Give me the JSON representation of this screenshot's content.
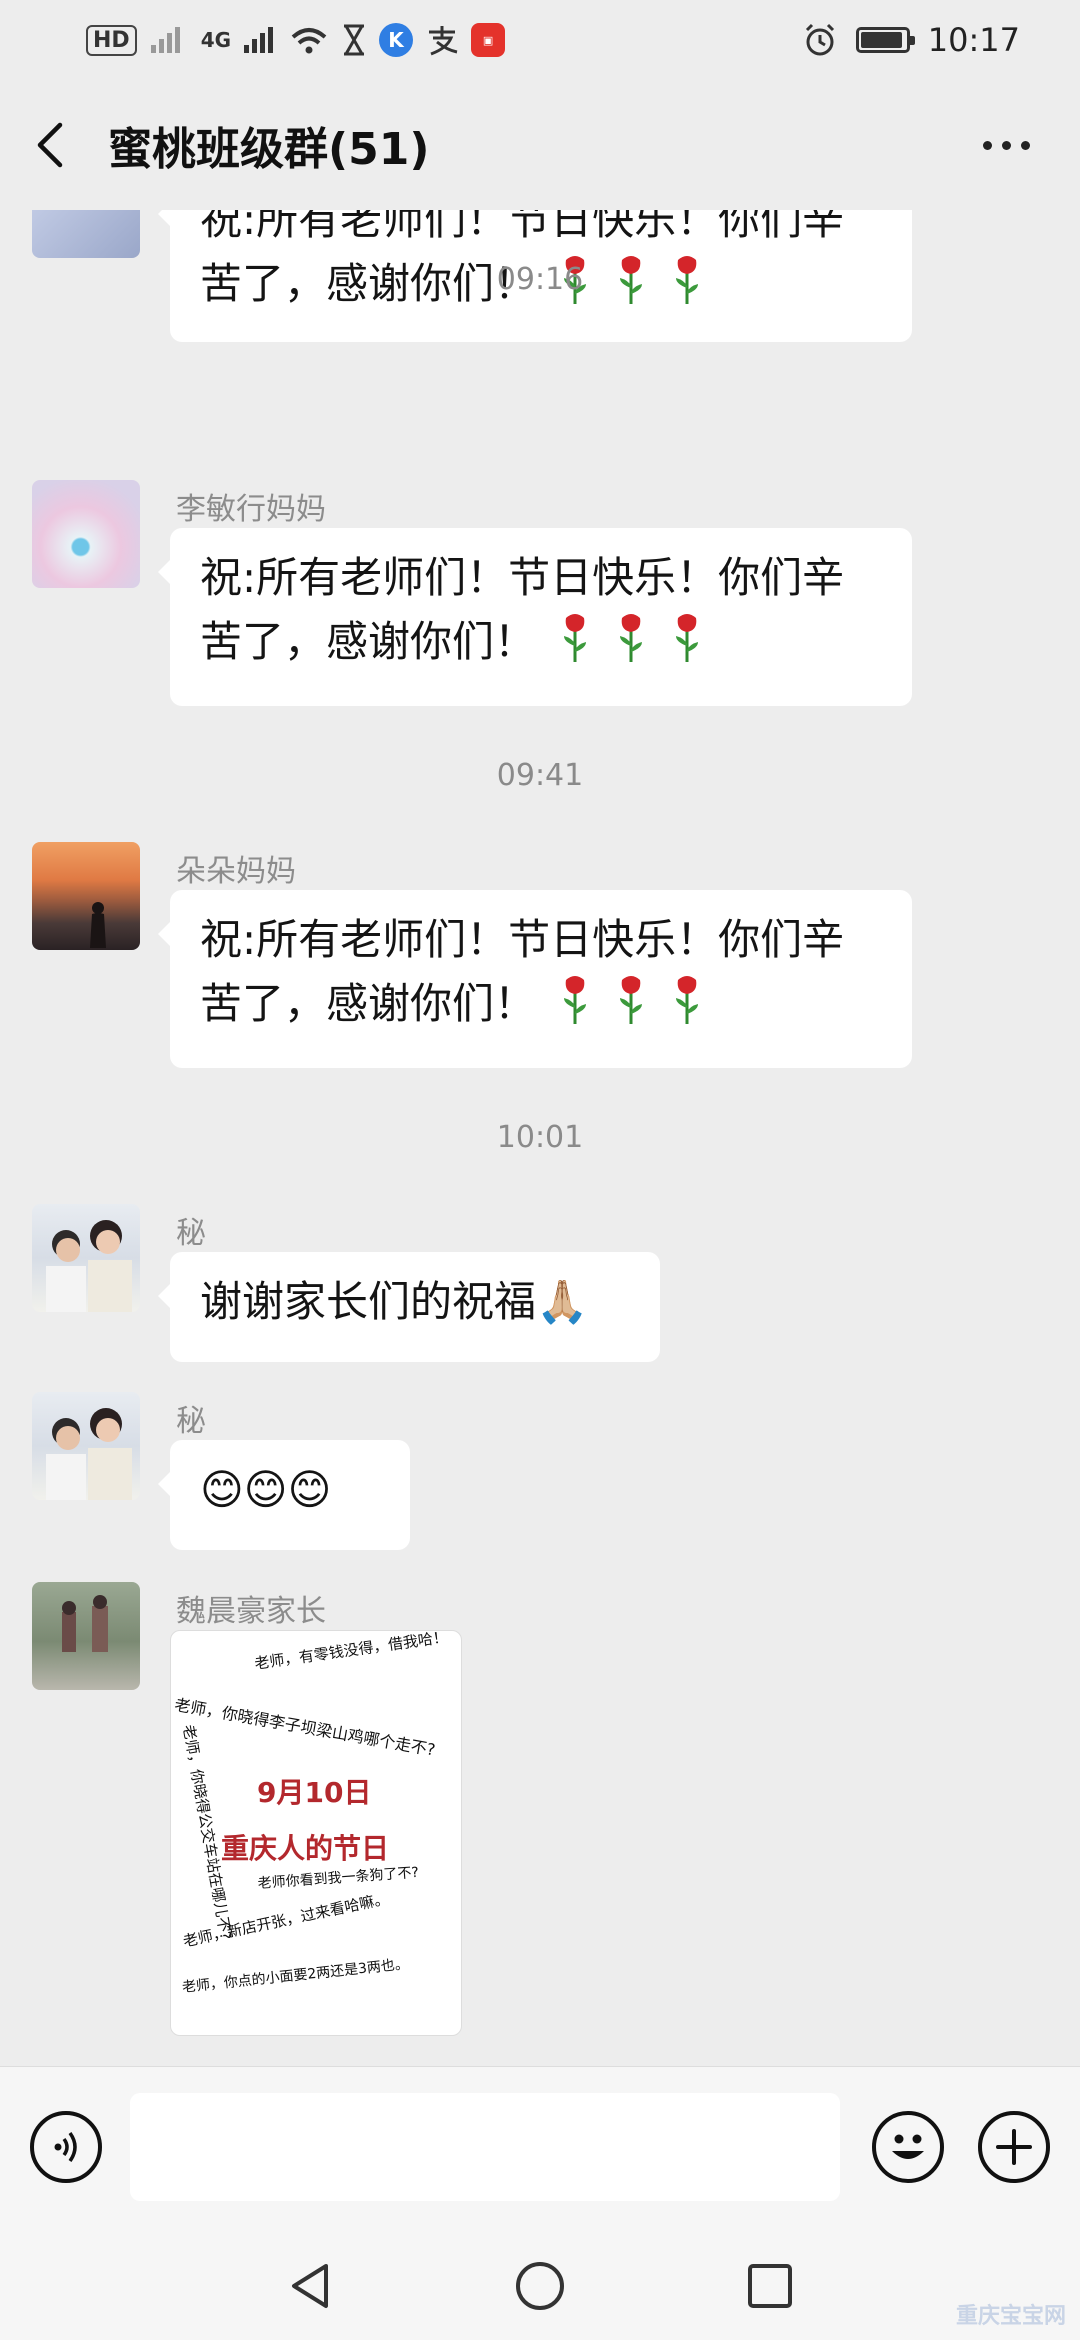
{
  "status_bar": {
    "left_chips": [
      "HD",
      "4G"
    ],
    "time": "10:17",
    "battery_level": 0.85
  },
  "header": {
    "back_icon": "chevron-left-icon",
    "title": "蜜桃班级群(51)",
    "more_icon": "more-dots-icon"
  },
  "messages": [
    {
      "type": "bubble",
      "text": "祝:所有老师们！节日快乐！你们辛苦了，感谢你们！",
      "roses": 3,
      "partial": true
    },
    {
      "type": "time",
      "text": "09:16"
    },
    {
      "type": "bubble",
      "sender": "李敏行妈妈",
      "text": "祝:所有老师们！节日快乐！你们辛苦了，感谢你们！",
      "roses": 3
    },
    {
      "type": "time",
      "text": "09:41"
    },
    {
      "type": "bubble",
      "sender": "朵朵妈妈",
      "text": "祝:所有老师们！节日快乐！你们辛苦了，感谢你们！",
      "roses": 3
    },
    {
      "type": "time",
      "text": "10:01"
    },
    {
      "type": "bubble",
      "sender": "秘",
      "text": "谢谢家长们的祝福",
      "emoji": "🙏🏼"
    },
    {
      "type": "bubble",
      "sender": "秘",
      "text": "😊😊😊"
    },
    {
      "type": "image",
      "sender": "魏晨豪家长"
    }
  ],
  "image_card": {
    "lines": [
      "老师，有零钱没得，借我哈！",
      "老师，你晓得李子坝梁山鸡哪个走不?",
      "老师，你晓得公交车站在哪儿不?",
      "9月10日",
      "重庆人的节日",
      "老师你看到我一条狗了不?",
      "老师，新店开张，过来看哈嘛。",
      "老师，你点的小面要2两还是3两也。"
    ]
  },
  "input_bar": {
    "voice_icon": "voice-icon",
    "emoji_icon": "emoji-icon",
    "plus_icon": "plus-icon"
  },
  "nav_bar": {
    "back_icon": "nav-back-icon",
    "home_icon": "nav-home-icon",
    "recents_icon": "nav-recents-icon"
  },
  "watermark": "重庆宝宝网"
}
